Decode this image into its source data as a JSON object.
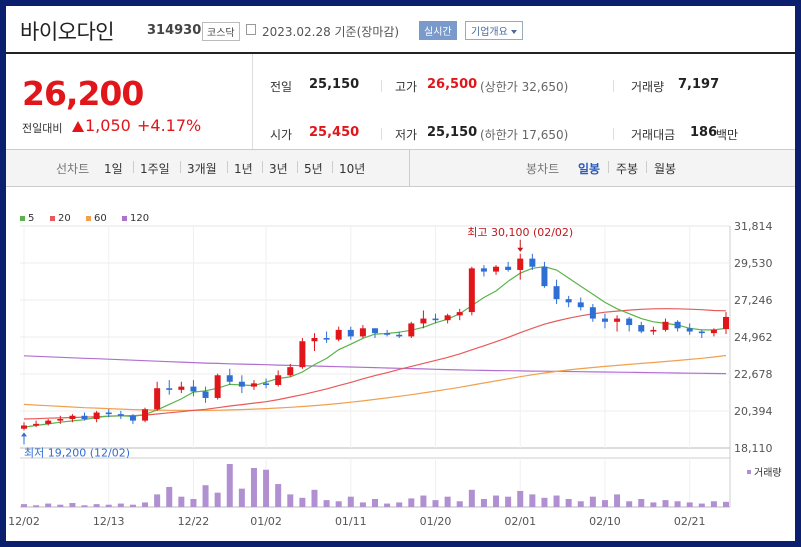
{
  "header": {
    "name": "바이오다인",
    "code": "314930",
    "market": "코스닥",
    "date": "2023.02.28 기준(장마감)",
    "realtime": "실시간",
    "overview": "기업개요"
  },
  "quote": {
    "price": "26,200",
    "prev_label": "전일대비",
    "change": "1,050",
    "change_pct": "+4.17%",
    "prev_close_label": "전일",
    "prev_close": "25,150",
    "open_label": "시가",
    "open": "25,450",
    "high_label": "고가",
    "high": "26,500",
    "upper_limit": "(상한가 32,650)",
    "low_label": "저가",
    "low": "25,150",
    "lower_limit": "(하한가 17,650)",
    "volume_label": "거래량",
    "volume": "7,197",
    "amount_label": "거래대금",
    "amount": "186",
    "amount_unit": "백만"
  },
  "tabs": {
    "line_chart": "선차트",
    "ranges": [
      "1일",
      "1주일",
      "3개월",
      "1년",
      "3년",
      "5년",
      "10년"
    ],
    "candle_chart": "봉차트",
    "periods": [
      "일봉",
      "주봉",
      "월봉"
    ],
    "active_period": 0
  },
  "colors": {
    "up": "#e0161b",
    "down": "#2f6fd4",
    "ma5": "#5ab34a",
    "ma20": "#e85a5a",
    "ma60": "#f0a050",
    "ma120": "#b070d0",
    "volume": "#b090d0"
  },
  "chart_data": {
    "type": "candlestick",
    "legend": [
      "5",
      "20",
      "60",
      "120"
    ],
    "ylim": [
      18110,
      31814
    ],
    "y_ticks": [
      "31,814",
      "29,530",
      "27,246",
      "24,962",
      "22,678",
      "20,394",
      "18,110"
    ],
    "x_tick_labels": [
      "12/02",
      "12/13",
      "12/22",
      "01/02",
      "01/11",
      "01/20",
      "02/01",
      "02/10",
      "02/21"
    ],
    "x_tick_index": [
      0,
      7,
      14,
      20,
      27,
      34,
      41,
      48,
      55
    ],
    "max_label": "최고 30,100 (02/02)",
    "max_index": 41,
    "min_label": "최저 19,200 (12/02)",
    "min_index": 0,
    "volume_label": "거래량",
    "candles": [
      [
        19300,
        19700,
        19200,
        19500
      ],
      [
        19500,
        19800,
        19400,
        19600
      ],
      [
        19600,
        19900,
        19500,
        19800
      ],
      [
        19800,
        20100,
        19600,
        19900
      ],
      [
        19900,
        20200,
        19700,
        20100
      ],
      [
        20100,
        20300,
        19800,
        19900
      ],
      [
        19900,
        20400,
        19700,
        20300
      ],
      [
        20300,
        20500,
        20000,
        20200
      ],
      [
        20200,
        20400,
        19900,
        20100
      ],
      [
        20100,
        20200,
        19600,
        19800
      ],
      [
        19800,
        20600,
        19700,
        20500
      ],
      [
        20500,
        22200,
        20400,
        21800
      ],
      [
        21800,
        22300,
        21400,
        21700
      ],
      [
        21700,
        22200,
        21500,
        21900
      ],
      [
        21900,
        22300,
        21300,
        21600
      ],
      [
        21600,
        21900,
        20900,
        21200
      ],
      [
        21200,
        22700,
        21100,
        22600
      ],
      [
        22600,
        23000,
        22000,
        22200
      ],
      [
        22200,
        22600,
        21500,
        21900
      ],
      [
        21900,
        22300,
        21700,
        22100
      ],
      [
        22100,
        22400,
        21800,
        22000
      ],
      [
        22000,
        22900,
        21900,
        22600
      ],
      [
        22600,
        23300,
        22500,
        23100
      ],
      [
        23100,
        24900,
        23000,
        24700
      ],
      [
        24700,
        25200,
        24100,
        24900
      ],
      [
        24900,
        25300,
        24600,
        24800
      ],
      [
        24800,
        25600,
        24700,
        25400
      ],
      [
        25400,
        25600,
        24800,
        25000
      ],
      [
        25000,
        25700,
        24900,
        25500
      ],
      [
        25500,
        25500,
        24900,
        25200
      ],
      [
        25200,
        25400,
        25000,
        25100
      ],
      [
        25100,
        25300,
        24900,
        25000
      ],
      [
        25000,
        25900,
        24900,
        25800
      ],
      [
        25800,
        26600,
        25500,
        26100
      ],
      [
        26100,
        26400,
        25800,
        26000
      ],
      [
        26000,
        26400,
        25800,
        26300
      ],
      [
        26300,
        26700,
        26000,
        26500
      ],
      [
        26500,
        29300,
        26300,
        29200
      ],
      [
        29200,
        29400,
        28700,
        29000
      ],
      [
        29000,
        29400,
        28800,
        29300
      ],
      [
        29300,
        29600,
        29000,
        29100
      ],
      [
        29100,
        30100,
        28500,
        29800
      ],
      [
        29800,
        30100,
        29100,
        29300
      ],
      [
        29300,
        29600,
        28000,
        28100
      ],
      [
        28100,
        28500,
        27000,
        27300
      ],
      [
        27300,
        27500,
        26800,
        27100
      ],
      [
        27100,
        27400,
        26600,
        26800
      ],
      [
        26800,
        27000,
        25900,
        26100
      ],
      [
        26100,
        26400,
        25500,
        25900
      ],
      [
        25900,
        26300,
        25300,
        26100
      ],
      [
        26100,
        26200,
        25300,
        25700
      ],
      [
        25700,
        25900,
        25200,
        25300
      ],
      [
        25300,
        25600,
        25100,
        25400
      ],
      [
        25400,
        26100,
        25300,
        25900
      ],
      [
        25900,
        26000,
        25300,
        25500
      ],
      [
        25500,
        25800,
        25100,
        25300
      ],
      [
        25300,
        25400,
        24900,
        25200
      ],
      [
        25200,
        25500,
        25000,
        25400
      ],
      [
        25450,
        26500,
        25150,
        26200
      ]
    ],
    "ma5": [
      19400,
      19500,
      19600,
      19700,
      19780,
      19860,
      20000,
      20080,
      20100,
      20060,
      20180,
      20460,
      20800,
      21140,
      21560,
      21640,
      21800,
      22040,
      22000,
      21960,
      22180,
      22400,
      22500,
      22800,
      23260,
      23640,
      24180,
      24520,
      24880,
      25140,
      25180,
      25260,
      25380,
      25560,
      25840,
      26060,
      26400,
      26900,
      27400,
      27800,
      28400,
      28900,
      29200,
      29300,
      29100,
      28600,
      28100,
      27600,
      27100,
      26700,
      26400,
      26100,
      25900,
      25800,
      25700,
      25500,
      25400,
      25400,
      25500
    ],
    "ma20": [
      19900,
      19920,
      19950,
      19970,
      19990,
      20010,
      20040,
      20070,
      20090,
      20110,
      20140,
      20210,
      20280,
      20350,
      20430,
      20500,
      20600,
      20700,
      20790,
      20880,
      20970,
      21100,
      21250,
      21400,
      21580,
      21760,
      21960,
      22160,
      22380,
      22580,
      22760,
      22960,
      23150,
      23330,
      23520,
      23700,
      23920,
      24170,
      24420,
      24670,
      24940,
      25230,
      25500,
      25750,
      25950,
      26120,
      26270,
      26390,
      26490,
      26560,
      26620,
      26670,
      26700,
      26710,
      26700,
      26680,
      26650,
      26600,
      26580
    ],
    "ma60": [
      20800,
      20760,
      20720,
      20680,
      20640,
      20600,
      20570,
      20540,
      20510,
      20480,
      20460,
      20450,
      20440,
      20430,
      20430,
      20430,
      20440,
      20460,
      20480,
      20510,
      20540,
      20580,
      20620,
      20670,
      20730,
      20790,
      20860,
      20940,
      21020,
      21110,
      21200,
      21300,
      21400,
      21510,
      21620,
      21740,
      21860,
      21990,
      22120,
      22250,
      22380,
      22510,
      22630,
      22740,
      22840,
      22930,
      23010,
      23080,
      23150,
      23210,
      23270,
      23330,
      23390,
      23450,
      23510,
      23580,
      23650,
      23730,
      23820
    ],
    "ma120": [
      23800,
      23770,
      23740,
      23710,
      23680,
      23650,
      23620,
      23590,
      23560,
      23530,
      23500,
      23470,
      23440,
      23410,
      23380,
      23350,
      23330,
      23310,
      23290,
      23270,
      23250,
      23230,
      23210,
      23190,
      23170,
      23150,
      23130,
      23110,
      23090,
      23070,
      23050,
      23030,
      23010,
      22990,
      22970,
      22950,
      22930,
      22910,
      22900,
      22890,
      22880,
      22870,
      22860,
      22850,
      22840,
      22830,
      22820,
      22810,
      22800,
      22790,
      22780,
      22770,
      22760,
      22750,
      22740,
      22730,
      22720,
      22710,
      22700
    ],
    "volume": [
      5,
      3,
      6,
      4,
      7,
      3,
      5,
      4,
      6,
      4,
      8,
      22,
      35,
      18,
      14,
      38,
      25,
      75,
      32,
      68,
      65,
      40,
      22,
      16,
      30,
      12,
      10,
      18,
      8,
      14,
      6,
      8,
      15,
      20,
      12,
      18,
      10,
      30,
      14,
      20,
      18,
      28,
      22,
      16,
      20,
      14,
      10,
      18,
      12,
      22,
      10,
      14,
      8,
      12,
      10,
      8,
      6,
      10,
      9
    ]
  }
}
